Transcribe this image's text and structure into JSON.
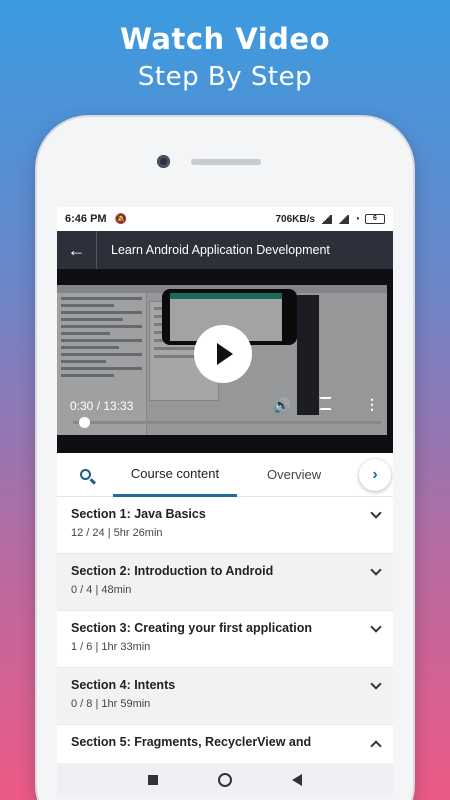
{
  "promo": {
    "title": "Watch  Video",
    "subtitle": "Step By Step"
  },
  "status": {
    "time": "6:46 PM",
    "network_speed": "706KB/s",
    "battery": "6"
  },
  "appbar": {
    "title": "Learn Android Application Development"
  },
  "video": {
    "time": "0:30 / 13:33",
    "progress": 0.037
  },
  "tabs": {
    "active": "Course content",
    "other": "Overview"
  },
  "sections": [
    {
      "title": "Section 1: Java Basics",
      "meta": "12 / 24 | 5hr 26min",
      "expanded": false
    },
    {
      "title": "Section 2: Introduction to Android",
      "meta": "0 / 4 | 48min",
      "expanded": false
    },
    {
      "title": "Section 3: Creating your first application",
      "meta": "1 / 6 | 1hr 33min",
      "expanded": false
    },
    {
      "title": "Section 4: Intents",
      "meta": "0 / 8 | 1hr 59min",
      "expanded": false
    },
    {
      "title": "Section 5: Fragments, RecyclerView and",
      "meta": "",
      "expanded": true
    }
  ]
}
